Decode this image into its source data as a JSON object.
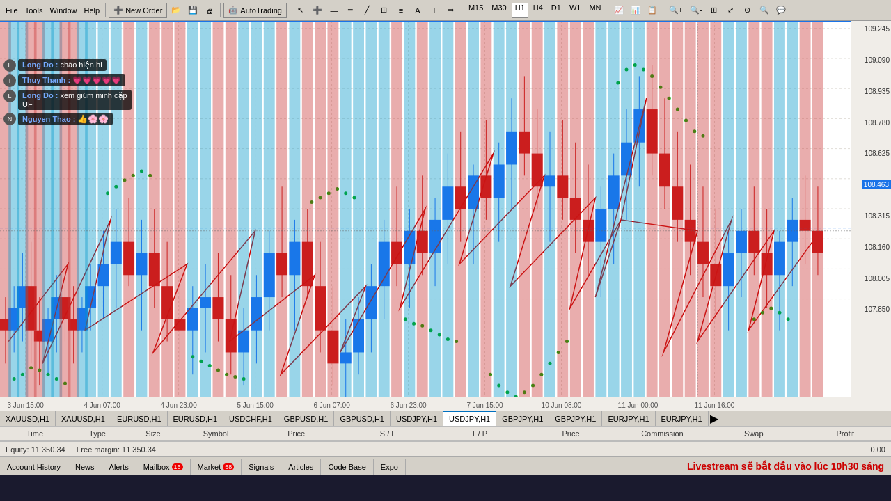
{
  "toolbar": {
    "new_order": "New Order",
    "autotrading": "AutoTrading",
    "timeframes": [
      "M15",
      "M30",
      "H1",
      "H4",
      "D1",
      "W1",
      "MN"
    ],
    "active_tf": "H1"
  },
  "chart": {
    "symbol": "USDJPY,H1",
    "current_price": "108.463",
    "price_top": "109.245",
    "price_labels": [
      {
        "value": "109.245",
        "pct": 2
      },
      {
        "value": "109.090",
        "pct": 10
      },
      {
        "value": "108.935",
        "pct": 18
      },
      {
        "value": "108.780",
        "pct": 26
      },
      {
        "value": "108.625",
        "pct": 34
      },
      {
        "value": "108.463",
        "pct": 42
      },
      {
        "value": "108.315",
        "pct": 50
      },
      {
        "value": "108.160",
        "pct": 58
      },
      {
        "value": "108.005",
        "pct": 66
      },
      {
        "value": "107.850",
        "pct": 74
      }
    ],
    "current_price_pct": 42,
    "time_labels": [
      {
        "label": "3 Jun 15:00",
        "pct": 3
      },
      {
        "label": "4 Jun 07:00",
        "pct": 12
      },
      {
        "label": "4 Jun 23:00",
        "pct": 21
      },
      {
        "label": "5 Jun 15:00",
        "pct": 30
      },
      {
        "label": "6 Jun 07:00",
        "pct": 39
      },
      {
        "label": "6 Jun 23:00",
        "pct": 48
      },
      {
        "label": "7 Jun 15:00",
        "pct": 57
      },
      {
        "label": "10 Jun 08:00",
        "pct": 66
      },
      {
        "label": "11 Jun 00:00",
        "pct": 75
      },
      {
        "label": "11 Jun 16:00",
        "pct": 84
      }
    ]
  },
  "symbol_tabs": [
    "XAUUSD,H1",
    "XAUUSD,H1",
    "EURUSD,H1",
    "EURUSD,H1",
    "USDCHF,H1",
    "GBPUSD,H1",
    "GBPUSD,H1",
    "USDJPY,H1",
    "USDJPY,H1",
    "GBPJPY,H1",
    "GBPJPY,H1",
    "EURJPY,H1",
    "EURJPY,H1"
  ],
  "active_symbol_tab": "USDJPY,H1",
  "table": {
    "columns": [
      "Time",
      "Type",
      "Size",
      "Symbol",
      "Price",
      "S / L",
      "T / P",
      "Price",
      "Commission",
      "Swap",
      "Profit"
    ]
  },
  "equity": {
    "label": "Equity: 11 350.34",
    "free_margin": "Free margin: 11 350.34",
    "profit": "0.00"
  },
  "bottom_tabs": [
    {
      "label": "Account History",
      "active": false
    },
    {
      "label": "News",
      "active": false
    },
    {
      "label": "Alerts",
      "active": false
    },
    {
      "label": "Mailbox",
      "active": false,
      "badge": "16"
    },
    {
      "label": "Market",
      "active": false,
      "badge": "58"
    },
    {
      "label": "Signals",
      "active": false
    },
    {
      "label": "Articles",
      "active": false
    },
    {
      "label": "Code Base",
      "active": false
    },
    {
      "label": "Expo",
      "active": false
    }
  ],
  "livestream_banner": "Livestream sẽ bắt đầu vào lúc 10h30 sáng",
  "chat": [
    {
      "name": "Long Do",
      "msg": "chào hiện hi",
      "avatar": "L"
    },
    {
      "name": "Thuy Thanh",
      "hearts": "💗💗💗💗💗",
      "avatar": "T"
    },
    {
      "name": "Long Do",
      "msg": "xem giúm minh cặp\nUF",
      "avatar": "L"
    },
    {
      "name": "Nguyen Thao",
      "emojis": "👍🌸🌸",
      "avatar": "N"
    }
  ]
}
